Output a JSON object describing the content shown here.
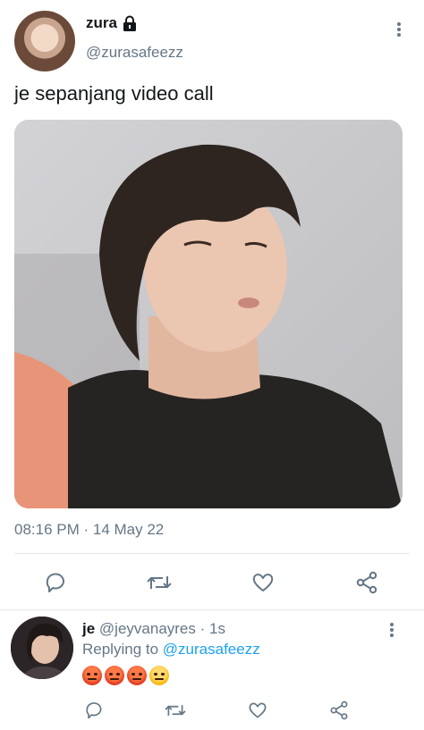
{
  "tweet": {
    "display_name": "zura",
    "handle": "@zurasafeezz",
    "text": "je sepanjang video call",
    "timestamp": "08:16 PM · 14 May 22"
  },
  "actions": {
    "reply_icon": "reply-icon",
    "retweet_icon": "retweet-icon",
    "like_icon": "heart-icon",
    "share_icon": "share-icon",
    "icon_color": "#657786"
  },
  "reply": {
    "display_name": "je",
    "meta": "@jeyvanayres · 1s",
    "replying_prefix": "Replying to",
    "replying_to": "@zurasafeezz",
    "emojis": [
      "angry-face",
      "angry-face",
      "angry-face",
      "expressionless-face"
    ]
  },
  "colors": {
    "secondary_text": "#657786",
    "link": "#1da1f2",
    "divider": "#e1e8ed"
  }
}
